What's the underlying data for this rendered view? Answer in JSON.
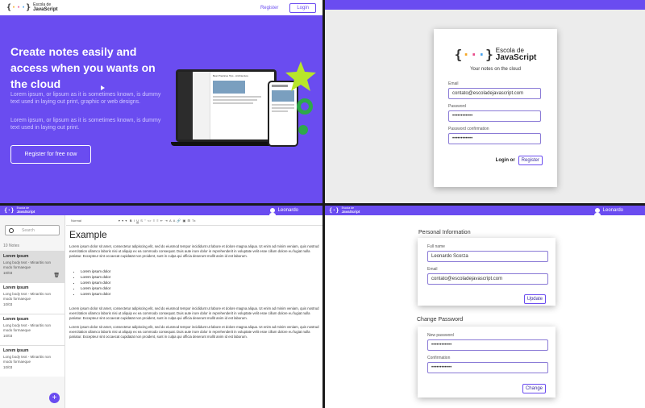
{
  "landing": {
    "logo_top": "Escola de",
    "logo_bottom": "JavaScript",
    "nav_register": "Register",
    "nav_login": "Login",
    "headline": "Create notes easily and access when you wants on the cloud",
    "para1": "Lorem ipsum, or lipsum as it is sometimes known, is dummy text used in laying out print, graphic or web designs.",
    "para2": "Lorem ipsum, or lipsum as it is sometimes known, is dummy text used in laying out print.",
    "cta": "Register for free now",
    "mock_title": "Best Practices Tips - Architecture"
  },
  "register": {
    "logo_top": "Escola de",
    "logo_bottom": "JavaScript",
    "subtitle": "Your notes on the cloud",
    "email_label": "Email",
    "email_value": "contato@escoladejavascript.com",
    "password_label": "Password",
    "password_value": "••••••••••••",
    "confirm_label": "Password confirmation",
    "confirm_value": "••••••••••••",
    "login_link": "Login or",
    "register_button": "Register"
  },
  "notes": {
    "logo_top": "Escola de",
    "logo_bottom": "JavaScript",
    "user": "Leonardo",
    "search_placeholder": "Search",
    "count": "10 Notes",
    "items": [
      {
        "title": "Lorem ipsum",
        "body": "Long body text - Minaritis non modo formaeque",
        "date": "10/03"
      },
      {
        "title": "Lorem ipsum",
        "body": "Long body text - Minaritis non modo formaeque",
        "date": "10/03"
      },
      {
        "title": "Lorem ipsum",
        "body": "Long body text - Minaritis non modo formaeque",
        "date": "10/03"
      },
      {
        "title": "Lorem ipsum",
        "body": "Long body text - Minaritis non modo formaeque",
        "date": "10/03"
      }
    ],
    "fab": "+",
    "format": "Normal",
    "title": "Example",
    "para": "Lorem ipsum dolor sit amet, consectetur adipiscing elit, sed do eiusmod tempor incididunt ut labore et dolore magna aliqua. Ut enim ad minim veniam, quis nostrud exercitation ullamco laboris nisi ut aliquip ex ea commodo consequat. Duis aute irure dolor in reprehenderit in voluptate velit esse cillum dolore eu fugiat nulla pariatur. Excepteur sint occaecat cupidatat non proident, sunt in culpa qui officia deserunt mollit anim id est laborum.",
    "bullets": [
      "Lorem ipsum dolor",
      "Lorem ipsum dolor",
      "Lorem ipsum dolor",
      "Lorem ipsum dolor",
      "Lorem ipsum dolor"
    ]
  },
  "profile": {
    "logo_top": "Escola de",
    "logo_bottom": "JavaScript",
    "user": "Leonardo",
    "personal_heading": "Personal Information",
    "name_label": "Full name",
    "name_value": "Leonardo Scorza",
    "email_label": "Email",
    "email_value": "contato@escoladejavascript.com",
    "update_button": "Update",
    "password_heading": "Change Password",
    "new_label": "New password",
    "new_value": "••••••••••••",
    "confirm_label": "Confirmation",
    "confirm_value": "••••••••••••",
    "change_button": "Change"
  },
  "colors": {
    "brand": "#6a4cf0",
    "accent": "#b8e62a"
  }
}
